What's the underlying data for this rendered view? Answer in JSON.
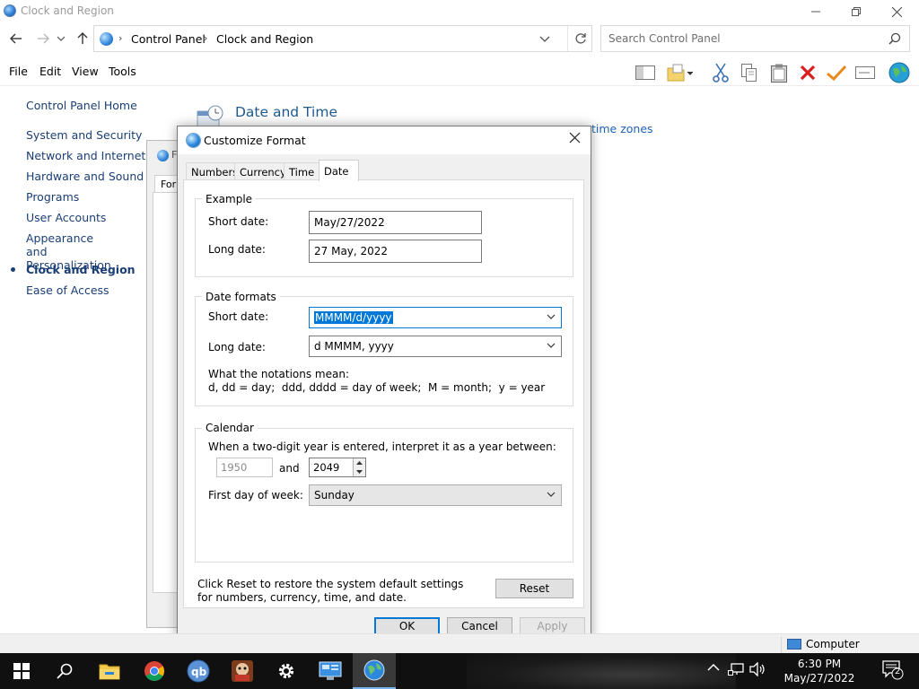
{
  "window": {
    "title": "Clock and Region",
    "address": {
      "crumbs": [
        "Control Panel",
        "Clock and Region"
      ]
    },
    "search": {
      "placeholder": "Search Control Panel"
    },
    "menu": [
      "File",
      "Edit",
      "View",
      "Tools"
    ],
    "sidebar": {
      "home": "Control Panel Home",
      "items": [
        "System and Security",
        "Network and Internet",
        "Hardware and Sound",
        "Programs",
        "User Accounts",
        "Appearance and Personalization",
        "Clock and Region",
        "Ease of Access"
      ],
      "active_index": 6
    },
    "section_title": "Date and Time",
    "section_link_partial": "time zones"
  },
  "region_dialog": {
    "title_partial": "F",
    "tab_partial": "Forn"
  },
  "customize_format": {
    "title": "Customize Format",
    "tabs": [
      "Numbers",
      "Currency",
      "Time",
      "Date"
    ],
    "active_tab": "Date",
    "example": {
      "legend": "Example",
      "short_label": "Short date:",
      "short_value": "May/27/2022",
      "long_label": "Long date:",
      "long_value": "27 May, 2022"
    },
    "date_formats": {
      "legend": "Date formats",
      "short_label": "Short date:",
      "short_value": "MMMM/d/yyyy",
      "long_label": "Long date:",
      "long_value": "d MMMM, yyyy",
      "notations_title": "What the notations mean:",
      "notations": "d, dd = day;  ddd, dddd = day of week;  M = month;  y = year"
    },
    "calendar": {
      "legend": "Calendar",
      "two_digit_text": "When a two-digit year is entered, interpret it as a year between:",
      "from_year": "1950",
      "and_label": "and",
      "to_year": "2049",
      "first_day_label": "First day of week:",
      "first_day_value": "Sunday"
    },
    "reset_note": "Click Reset to restore the system default settings for numbers, currency, time, and date.",
    "buttons": {
      "reset": "Reset",
      "ok": "OK",
      "cancel": "Cancel",
      "apply": "Apply"
    }
  },
  "status": {
    "text": "Computer"
  },
  "taskbar": {
    "apps": [
      "start-icon",
      "search-icon",
      "file-explorer-icon",
      "chrome-icon",
      "qbittorrent-icon",
      "game-icon",
      "settings-icon",
      "control-panel-icon",
      "region-globe-icon"
    ],
    "time": "6:30 PM",
    "date": "May/27/2022",
    "notification_count": "2"
  },
  "colors": {
    "accent": "#0078d7",
    "link": "#1a3e74",
    "heading": "#1e5a8c",
    "taskbar": "#101010"
  }
}
